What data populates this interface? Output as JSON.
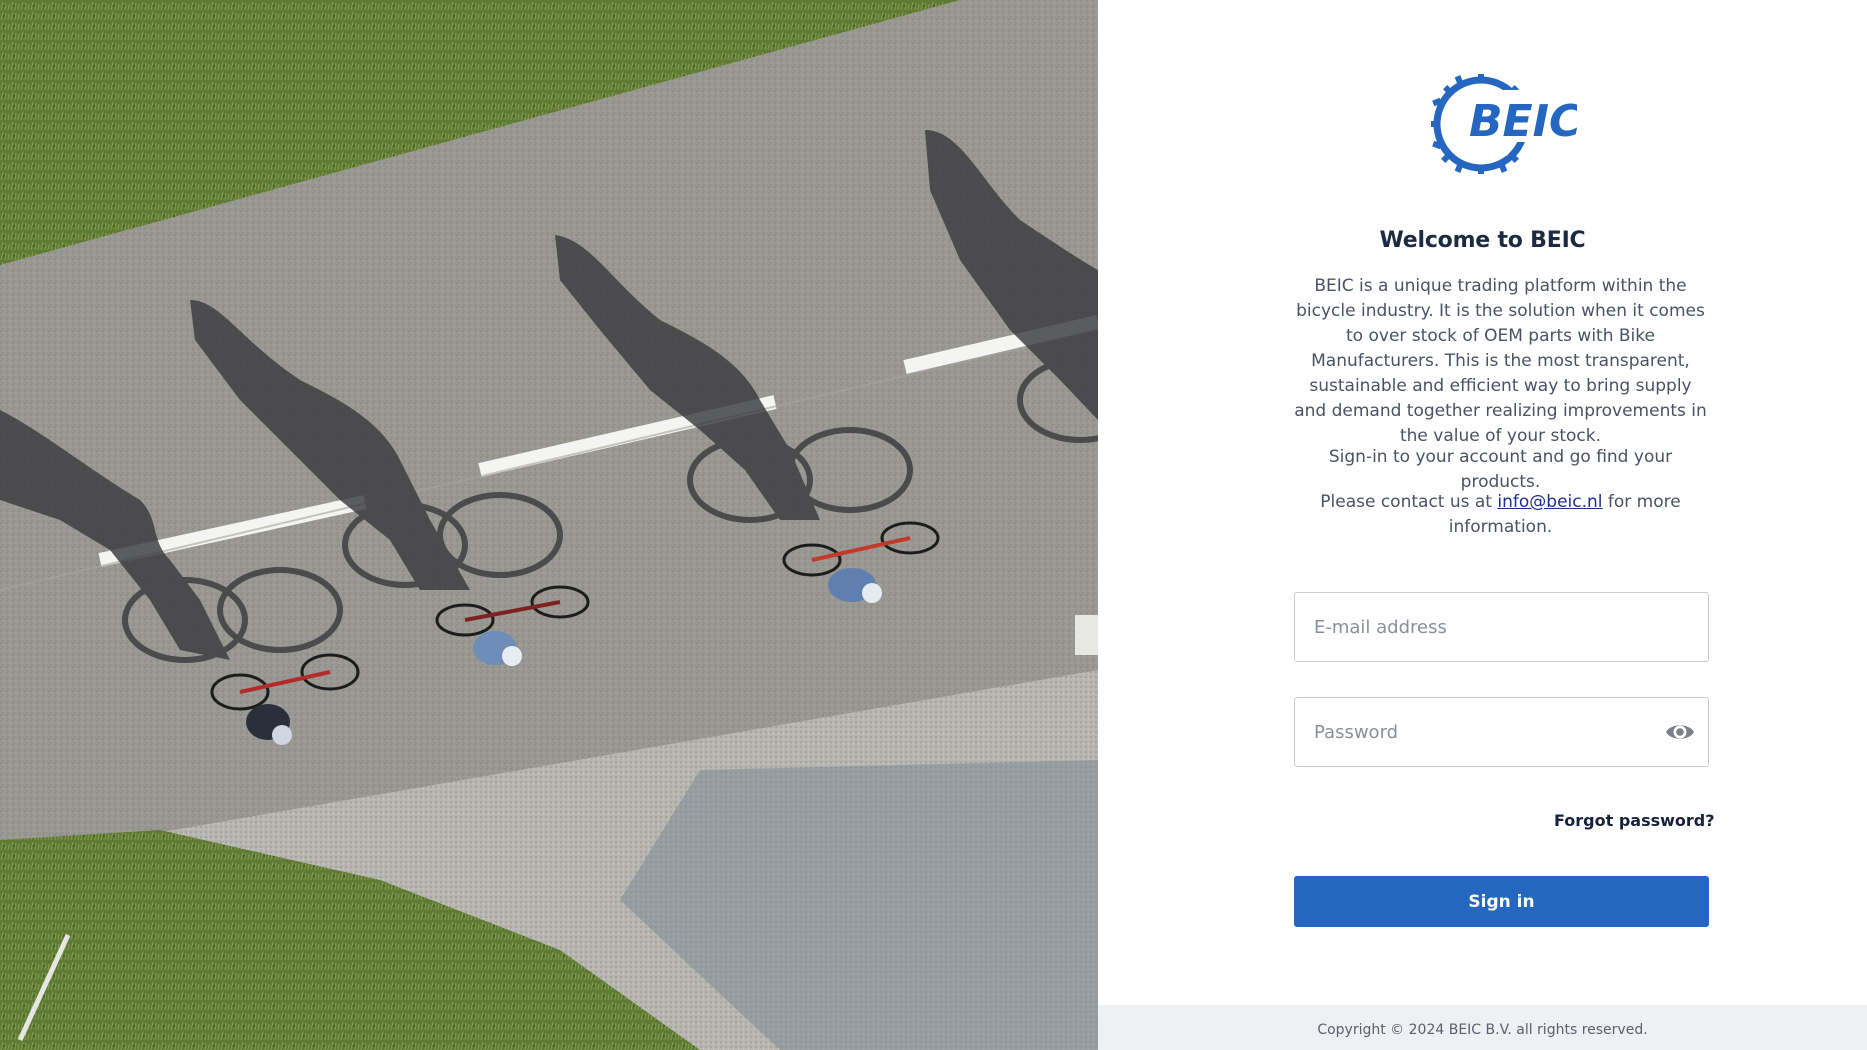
{
  "hero": {
    "description_icon": "cyclists-aerial-photo"
  },
  "brand": {
    "logo_text": "BEIC",
    "logo_icon": "chainring-logo-icon",
    "accent_color": "#2466c0"
  },
  "welcome": {
    "title": "Welcome to BEIC",
    "description": "BEIC is a unique trading platform within the bicycle industry. It is the solution when it comes to over stock of OEM parts with Bike Manufacturers. This is the most transparent, sustainable and efficient way to bring supply and demand together realizing improvements in the value of your stock.",
    "signin_note": "Sign-in to your account and go find your products.",
    "contact_prefix": "Please contact us at ",
    "contact_email": "info@beic.nl",
    "contact_suffix": " for more information."
  },
  "form": {
    "email_placeholder": "E-mail address",
    "email_value": "",
    "password_placeholder": "Password",
    "password_value": "",
    "show_password_icon": "eye-icon",
    "forgot_label": "Forgot password?",
    "signin_label": "Sign in"
  },
  "footer": {
    "copyright": "Copyright © 2024 BEIC B.V. all rights reserved."
  }
}
